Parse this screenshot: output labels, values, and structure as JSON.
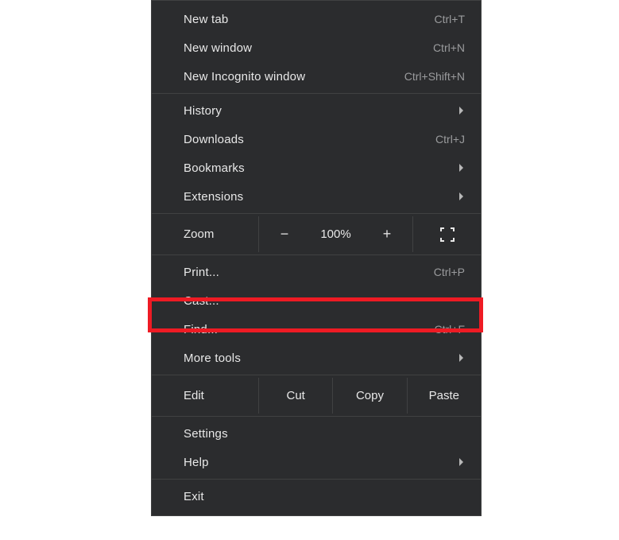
{
  "menu": {
    "new_tab": {
      "label": "New tab",
      "shortcut": "Ctrl+T"
    },
    "new_window": {
      "label": "New window",
      "shortcut": "Ctrl+N"
    },
    "new_incognito": {
      "label": "New Incognito window",
      "shortcut": "Ctrl+Shift+N"
    },
    "history": {
      "label": "History"
    },
    "downloads": {
      "label": "Downloads",
      "shortcut": "Ctrl+J"
    },
    "bookmarks": {
      "label": "Bookmarks"
    },
    "extensions": {
      "label": "Extensions"
    },
    "zoom": {
      "label": "Zoom",
      "minus": "−",
      "level": "100%",
      "plus": "+"
    },
    "print": {
      "label": "Print...",
      "shortcut": "Ctrl+P"
    },
    "cast": {
      "label": "Cast..."
    },
    "find": {
      "label": "Find...",
      "shortcut": "Ctrl+F"
    },
    "more_tools": {
      "label": "More tools"
    },
    "edit": {
      "label": "Edit",
      "cut": "Cut",
      "copy": "Copy",
      "paste": "Paste"
    },
    "settings": {
      "label": "Settings"
    },
    "help": {
      "label": "Help"
    },
    "exit": {
      "label": "Exit"
    }
  }
}
